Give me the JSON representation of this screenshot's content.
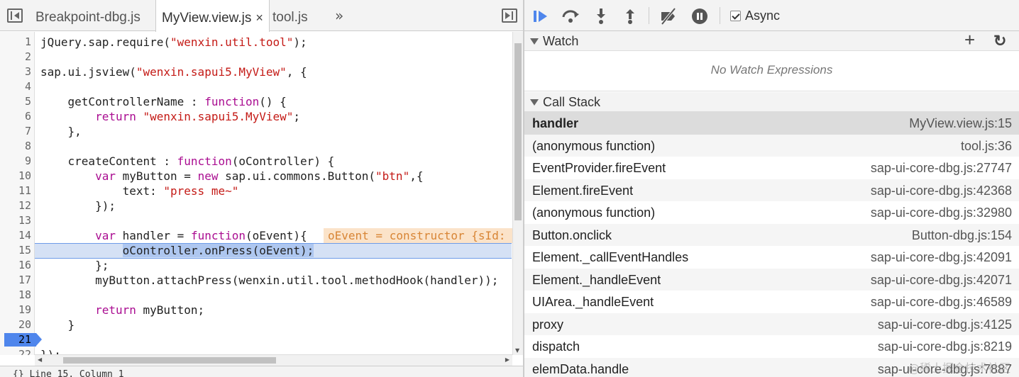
{
  "tabs": {
    "items": [
      {
        "label": "Breakpoint-dbg.js"
      },
      {
        "label": "MyView.view.js",
        "active": true,
        "close": "×"
      },
      {
        "label": "tool.js"
      }
    ],
    "more": "»"
  },
  "editor": {
    "current_line": 21,
    "paused_line": 15,
    "lines": [
      {
        "n": "1"
      },
      {
        "n": "2"
      },
      {
        "n": "3"
      },
      {
        "n": "4"
      },
      {
        "n": "5"
      },
      {
        "n": "6"
      },
      {
        "n": "7"
      },
      {
        "n": "8"
      },
      {
        "n": "9"
      },
      {
        "n": "10"
      },
      {
        "n": "11"
      },
      {
        "n": "12"
      },
      {
        "n": "13"
      },
      {
        "n": "14"
      },
      {
        "n": "15"
      },
      {
        "n": "16"
      },
      {
        "n": "17"
      },
      {
        "n": "18"
      },
      {
        "n": "19"
      },
      {
        "n": "20"
      },
      {
        "n": "21"
      },
      {
        "n": "22"
      }
    ],
    "code": {
      "l1a": "jQuery.sap.require(",
      "l1s": "\"wenxin.util.tool\"",
      "l1b": ");",
      "l3a": "sap.ui.jsview(",
      "l3s": "\"wenxin.sapui5.MyView\"",
      "l3b": ", {",
      "l5a": "    getControllerName : ",
      "l5k": "function",
      "l5b": "() {",
      "l6k": "        return ",
      "l6s": "\"wenxin.sapui5.MyView\"",
      "l6b": ";",
      "l7": "    },",
      "l9a": "    createContent : ",
      "l9k": "function",
      "l9b": "(oController) {",
      "l10k": "        var",
      "l10a": " myButton = ",
      "l10k2": "new",
      "l10b": " sap.ui.commons.Button(",
      "l10s": "\"btn\"",
      "l10c": ",{",
      "l11a": "            text: ",
      "l11s": "\"press me~\"",
      "l12": "        });",
      "l14k": "        var",
      "l14a": " handler = ",
      "l14k2": "function",
      "l14b": "(oEvent){",
      "l14inline": "oEvent = constructor {sId:",
      "l15pre": "            ",
      "l15sel": "oController.onPress(oEvent);",
      "l16": "        };",
      "l17": "        myButton.attachPress(wenxin.util.tool.methodHook(handler));",
      "l19k": "        return",
      "l19a": " myButton;",
      "l20": "    }",
      "l22": "});"
    }
  },
  "bottom": {
    "text": "{}   Line 15, Column 1"
  },
  "toolbar": {
    "async_label": "Async",
    "async_checked": true
  },
  "watch": {
    "title": "Watch",
    "add": "+",
    "refresh": "↻",
    "empty": "No Watch Expressions"
  },
  "callstack": {
    "title": "Call Stack",
    "frames": [
      {
        "fn": "handler",
        "loc": "MyView.view.js:15"
      },
      {
        "fn": "(anonymous function)",
        "loc": "tool.js:36"
      },
      {
        "fn": "EventProvider.fireEvent",
        "loc": "sap-ui-core-dbg.js:27747"
      },
      {
        "fn": "Element.fireEvent",
        "loc": "sap-ui-core-dbg.js:42368"
      },
      {
        "fn": "(anonymous function)",
        "loc": "sap-ui-core-dbg.js:32980"
      },
      {
        "fn": "Button.onclick",
        "loc": "Button-dbg.js:154"
      },
      {
        "fn": "Element._callEventHandles",
        "loc": "sap-ui-core-dbg.js:42091"
      },
      {
        "fn": "Element._handleEvent",
        "loc": "sap-ui-core-dbg.js:42071"
      },
      {
        "fn": "UIArea._handleEvent",
        "loc": "sap-ui-core-dbg.js:46589"
      },
      {
        "fn": "proxy",
        "loc": "sap-ui-core-dbg.js:4125"
      },
      {
        "fn": "dispatch",
        "loc": "sap-ui-core-dbg.js:8219"
      },
      {
        "fn": "elemData.handle",
        "loc": "sap-ui-core-dbg.js:7887"
      }
    ]
  },
  "watermark": "@稀土掘金技术社区",
  "colors": {
    "accent": "#4f86ec",
    "keyword": "#aa0d91",
    "string": "#c41a16"
  }
}
